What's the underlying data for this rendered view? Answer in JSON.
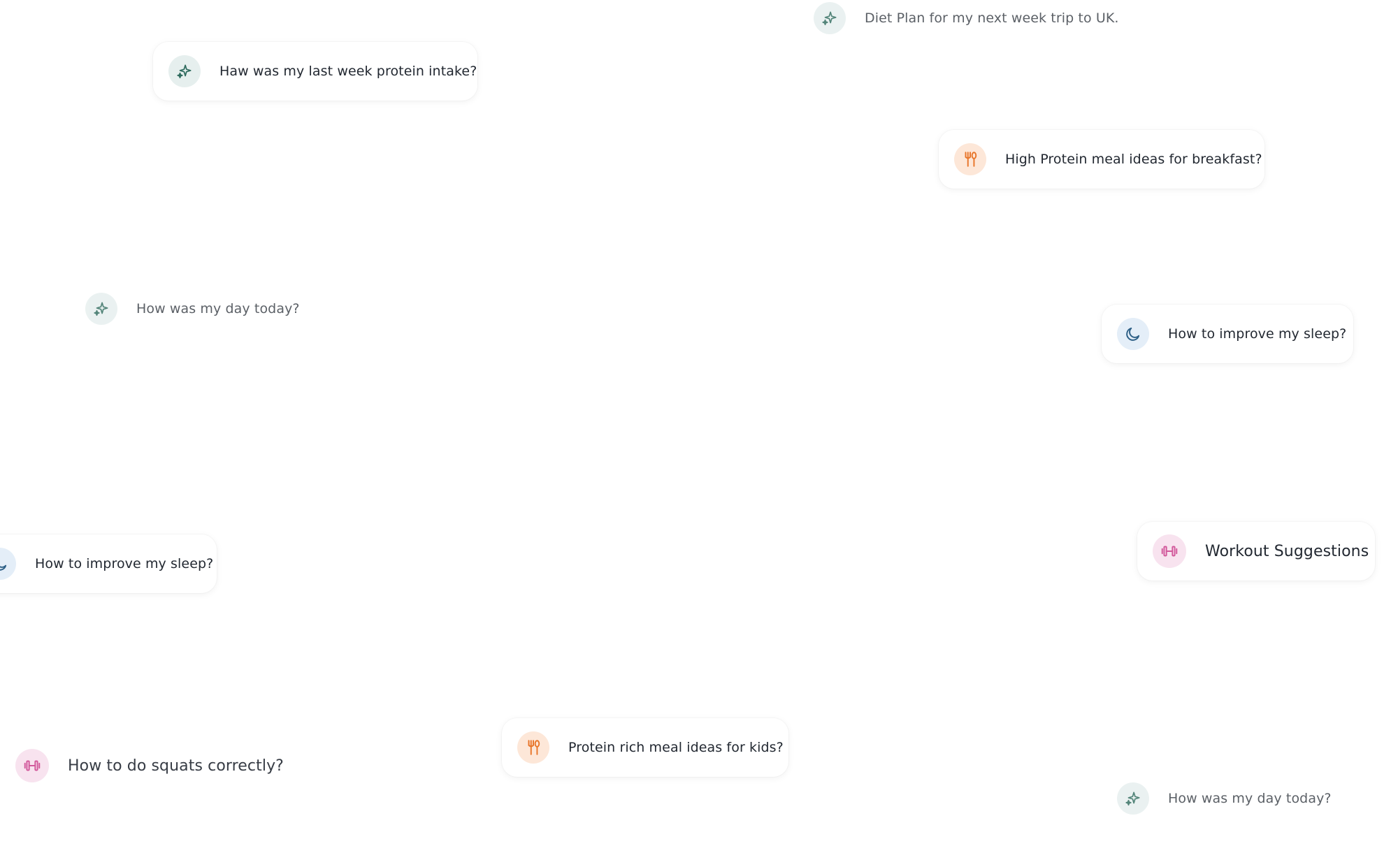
{
  "colors": {
    "ai_icon": "#2f6b5e",
    "ai_bg": "#e6efee",
    "food_icon": "#e8762b",
    "food_bg": "#fde7d8",
    "moon_icon": "#2d5f86",
    "moon_bg": "#e4eef8",
    "dumbbell_icon": "#d2589b",
    "dumbbell_bg": "#f8e3ef"
  },
  "suggestions": [
    {
      "icon": "sparkle-icon",
      "label": "Diet Plan for my next week trip to UK."
    },
    {
      "icon": "sparkle-icon",
      "label": "Haw was my last week protein intake?"
    },
    {
      "icon": "fork-spoon-icon",
      "label": "High Protein meal ideas for breakfast?"
    },
    {
      "icon": "sparkle-icon",
      "label": "How was my day today?"
    },
    {
      "icon": "moon-icon",
      "label": "How to improve my sleep?"
    },
    {
      "icon": "moon-icon",
      "label": "How to improve my sleep?"
    },
    {
      "icon": "dumbbell-icon",
      "label": "Workout Suggestions"
    },
    {
      "icon": "dumbbell-icon",
      "label": "How to do squats correctly?"
    },
    {
      "icon": "fork-spoon-icon",
      "label": "Protein rich meal ideas for kids?"
    },
    {
      "icon": "sparkle-icon",
      "label": "How was my day today?"
    }
  ]
}
